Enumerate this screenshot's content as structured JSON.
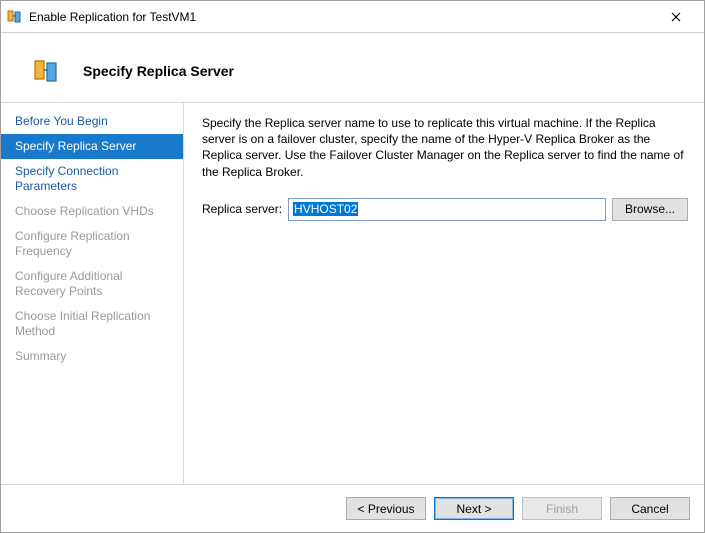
{
  "window": {
    "title": "Enable Replication for TestVM1"
  },
  "header": {
    "heading": "Specify Replica Server"
  },
  "sidebar": {
    "steps": [
      {
        "label": "Before You Begin"
      },
      {
        "label": "Specify Replica Server"
      },
      {
        "label": "Specify Connection Parameters"
      },
      {
        "label": "Choose Replication VHDs"
      },
      {
        "label": "Configure Replication Frequency"
      },
      {
        "label": "Configure Additional Recovery Points"
      },
      {
        "label": "Choose Initial Replication Method"
      },
      {
        "label": "Summary"
      }
    ]
  },
  "content": {
    "description": "Specify the Replica server name to use to replicate this virtual machine. If the Replica server is on a failover cluster, specify the name of the Hyper-V Replica Broker as the Replica server. Use the Failover Cluster Manager on the Replica server to find the name of the Replica Broker.",
    "replica_label": "Replica server:",
    "replica_value": "HVHOST02",
    "browse_label": "Browse..."
  },
  "footer": {
    "previous": "< Previous",
    "next": "Next >",
    "finish": "Finish",
    "cancel": "Cancel"
  }
}
